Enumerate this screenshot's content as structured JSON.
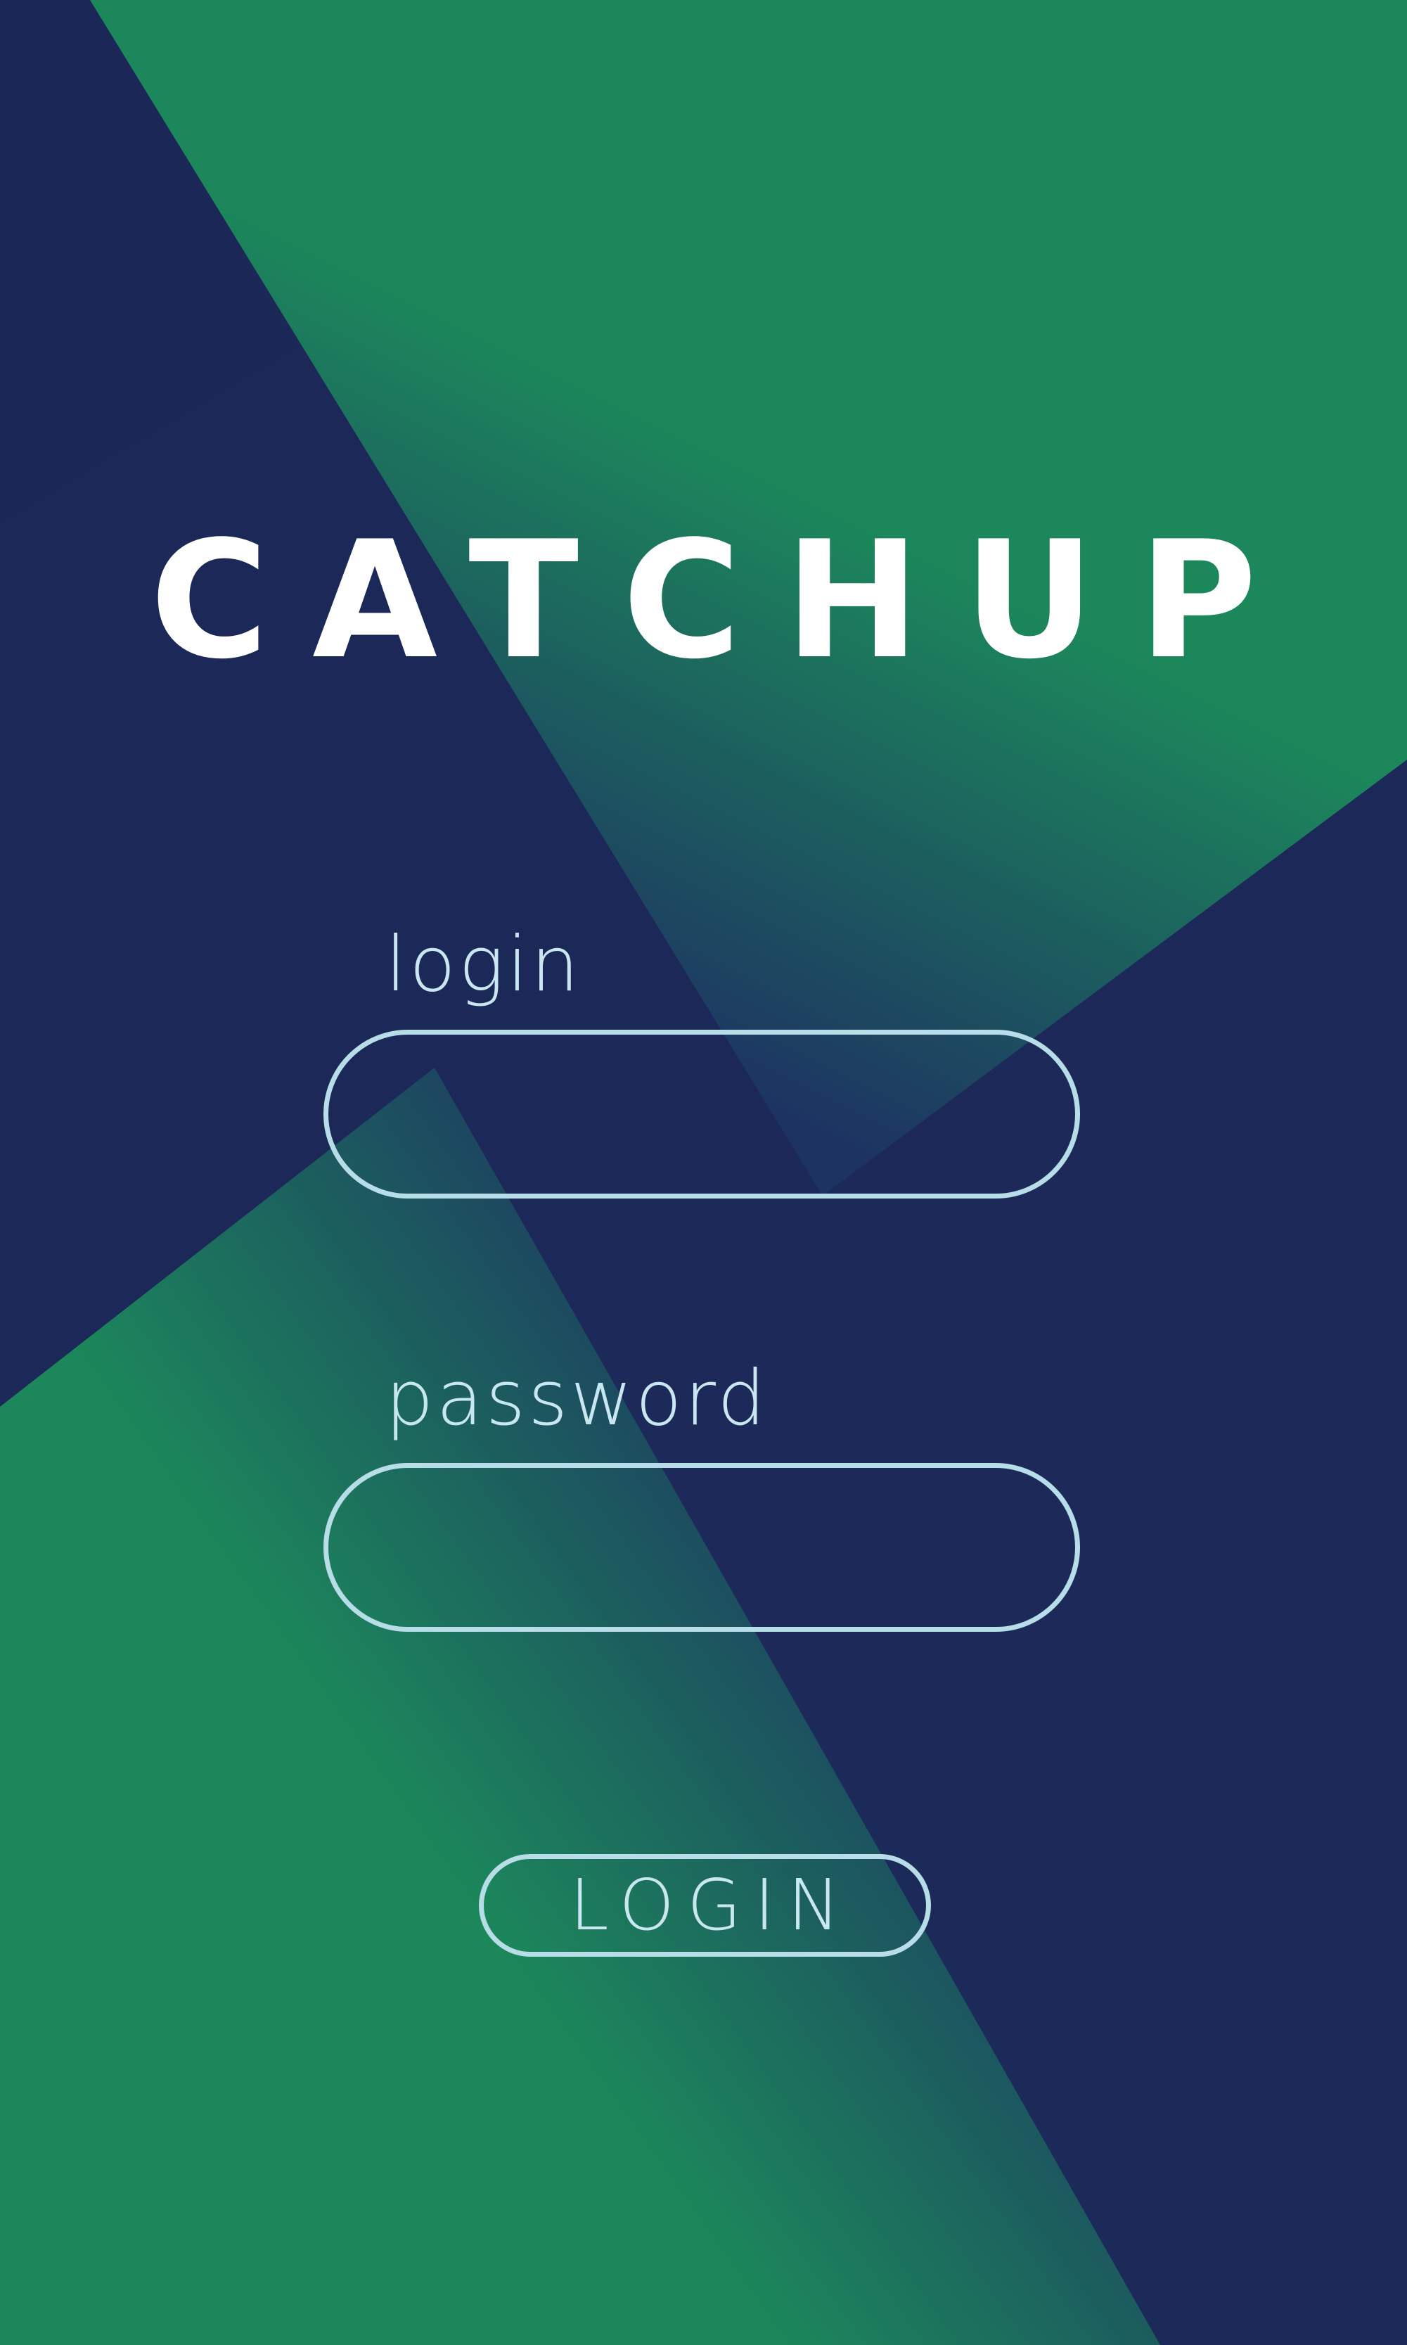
{
  "app": {
    "logo_text": "CATCHUP"
  },
  "form": {
    "login_label": "login",
    "login_value": "",
    "password_label": "password",
    "password_value": "",
    "submit_label": "LOGIN"
  },
  "colors": {
    "navy": "#1b2858",
    "green": "#1c875b",
    "outline": "#b7dde8",
    "label_text": "#c9e7f0",
    "logo_text": "#ffffff"
  }
}
